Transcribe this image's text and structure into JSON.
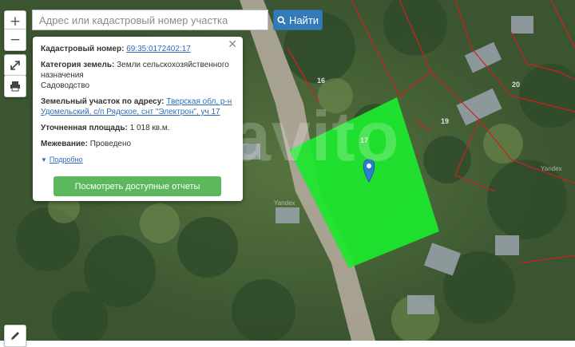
{
  "search": {
    "placeholder": "Адрес или кадастровый номер участка",
    "button_label": "Найти"
  },
  "controls": {
    "zoom_in": "+",
    "zoom_out": "−"
  },
  "popup": {
    "cadastral_label": "Кадастровый номер:",
    "cadastral_value": "69:35:0172402:17",
    "category_label": "Категория земель:",
    "category_value": "Земли сельскохозяйственного назначения",
    "category_use": "Садоводство",
    "address_label": "Земельный участок по адресу:",
    "address_value": "Тверская обл, р-н Удомельский, с/п Рядское, снт \"Электрон\", уч 17",
    "area_label": "Уточненная площадь:",
    "area_value": "1 018 кв.м.",
    "survey_label": "Межевание:",
    "survey_value": "Проведено",
    "more_label": "Подробно",
    "report_button": "Посмотреть доступные отчеты"
  },
  "map": {
    "plot_labels": [
      "16",
      "17",
      "19",
      "20"
    ],
    "attribution": [
      "Yandex",
      "Yandex"
    ],
    "watermark": "avito",
    "parcel_color": "#1ee62e",
    "boundary_color": "#d21f1f",
    "marker_color": "#2c7fcf"
  }
}
